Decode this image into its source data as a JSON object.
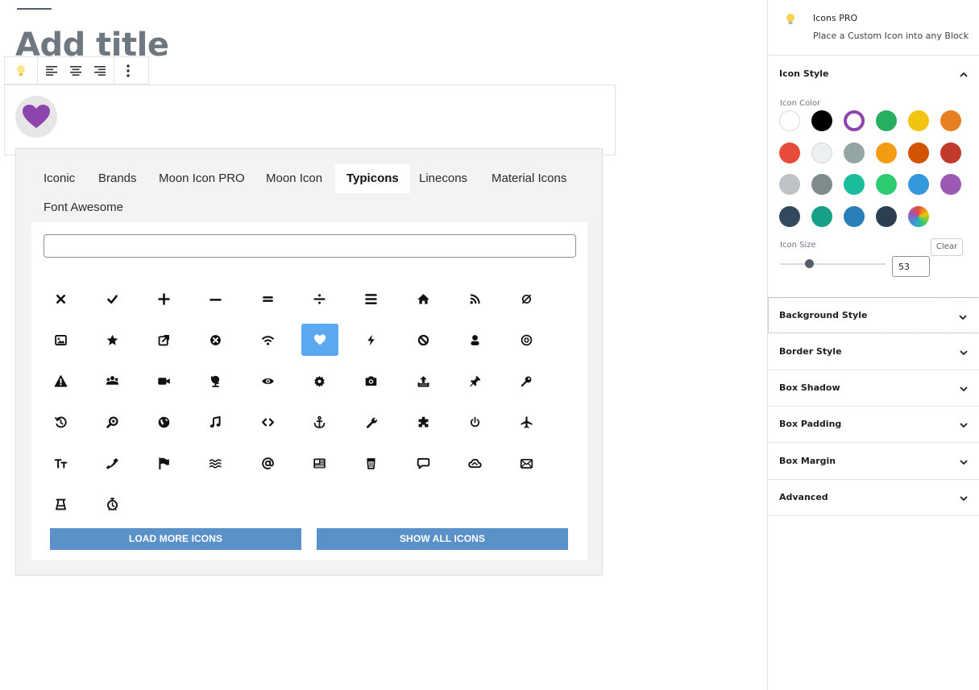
{
  "editor": {
    "title": "Add title"
  },
  "toolbar": {
    "items": [
      "block-icon",
      "align-left",
      "align-center",
      "align-right",
      "more-options"
    ]
  },
  "picker": {
    "tabs": [
      {
        "label": "Iconic",
        "active": false
      },
      {
        "label": "Brands",
        "active": false
      },
      {
        "label": "Moon Icon PRO",
        "active": false
      },
      {
        "label": "Moon Icon",
        "active": false
      },
      {
        "label": "Typicons",
        "active": true
      },
      {
        "label": "Linecons",
        "active": false
      },
      {
        "label": "Material Icons",
        "active": false
      },
      {
        "label": "Font Awesome",
        "active": false
      }
    ],
    "search": {
      "value": "",
      "placeholder": ""
    },
    "icons": [
      "times",
      "tick",
      "plus",
      "minus",
      "equals",
      "divide",
      "th-menu",
      "home",
      "rss",
      "cancel",
      "image",
      "star",
      "export",
      "delete",
      "wifi",
      "heart",
      "flash",
      "block",
      "user",
      "plus-circle",
      "warning",
      "group",
      "video",
      "globe",
      "eye",
      "cog",
      "camera",
      "upload",
      "pin",
      "key",
      "history",
      "zoom",
      "world",
      "music",
      "code",
      "anchor",
      "spanner",
      "puzzle",
      "power",
      "plane",
      "text-size",
      "phone",
      "flag",
      "waves",
      "at",
      "news",
      "trash",
      "message",
      "weather-cloudy",
      "mail",
      "beaker",
      "stopwatch"
    ],
    "selected_icon": "heart",
    "load_more_label": "LOAD MORE ICONS",
    "show_all_label": "SHOW ALL ICONS"
  },
  "sidebar": {
    "block": {
      "name": "Icons PRO",
      "description": "Place a Custom Icon into any Block"
    },
    "icon_style": {
      "title": "Icon Style",
      "color_label": "Icon Color",
      "colors": [
        "#ffffff",
        "#000000",
        "#8e44ad",
        "#27ae60",
        "#f1c40f",
        "#e67e22",
        "#e74c3c",
        "#ecf0f1",
        "#95a5a6",
        "#f39c12",
        "#d35400",
        "#c0392b",
        "#bdc3c7",
        "#7f8c8d",
        "#1abc9c",
        "#2ecc71",
        "#3498db",
        "#9b59b6",
        "#34495e",
        "#16a085",
        "#2980b9",
        "#2c3e50",
        "gradient"
      ],
      "selected_color": "#8e44ad",
      "size_label": "Icon Size",
      "clear_label": "Clear",
      "size_value": "53",
      "size_fraction": 0.28
    },
    "panels": [
      {
        "label": "Background Style"
      },
      {
        "label": "Border Style"
      },
      {
        "label": "Box Shadow"
      },
      {
        "label": "Box Padding"
      },
      {
        "label": "Box Margin"
      },
      {
        "label": "Advanced"
      }
    ]
  },
  "colors": {
    "preview_icon": "#8e44ad",
    "selection": "#5aa8f0",
    "button": "#5b91c9"
  }
}
